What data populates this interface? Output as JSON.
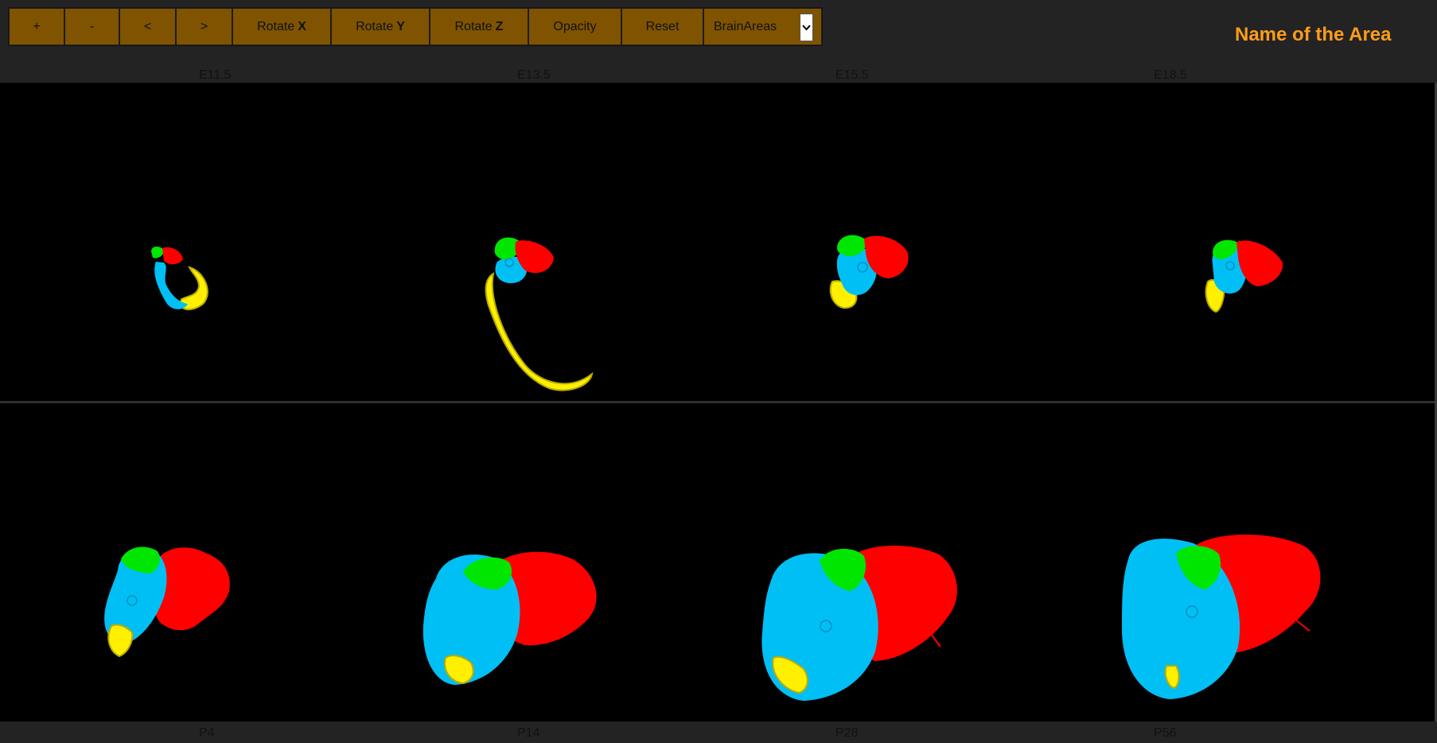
{
  "toolbar": {
    "zoom_in": "+",
    "zoom_out": "-",
    "prev": "<",
    "next": ">",
    "rotate_x_prefix": "Rotate",
    "rotate_x_axis": "X",
    "rotate_y_prefix": "Rotate",
    "rotate_y_axis": "Y",
    "rotate_z_prefix": "Rotate",
    "rotate_z_axis": "Z",
    "opacity": "Opacity",
    "reset": "Reset",
    "select_value": "BrainAreas"
  },
  "area_name": "Name of the Area",
  "top_stages": [
    "E11.5",
    "E13.5",
    "E15.5",
    "E18.5"
  ],
  "bottom_stages": [
    "P4",
    "P14",
    "P28",
    "P56"
  ],
  "colors": {
    "accent": "#7f5300",
    "area_name": "#ff9d1a",
    "region_blue": "#00bff5",
    "region_red": "#ff0000",
    "region_green": "#00e600",
    "region_yellow": "#fff000"
  }
}
